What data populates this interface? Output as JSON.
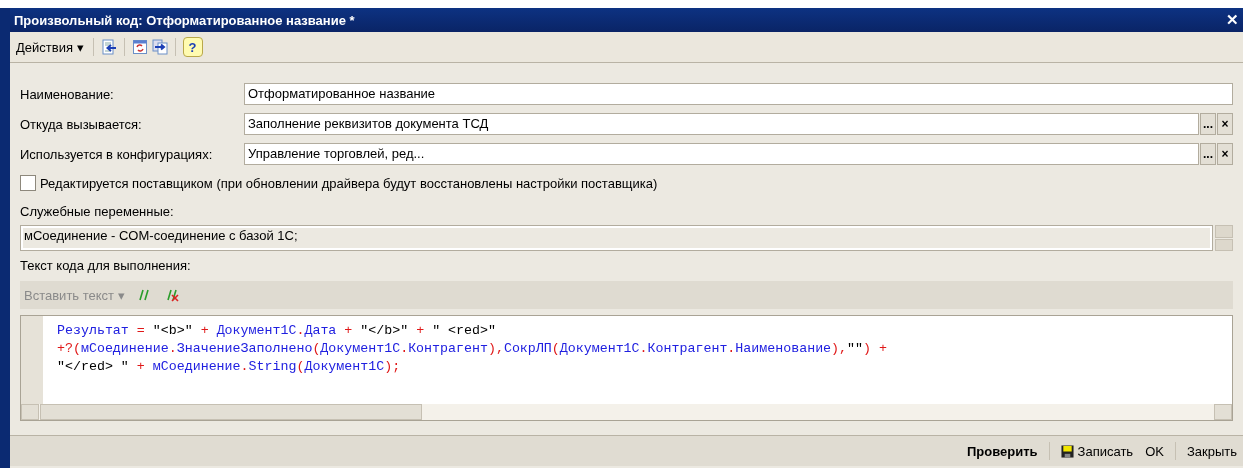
{
  "window": {
    "title": "Произвольный код: Отформатированное название *",
    "close": "✕"
  },
  "toolbar": {
    "menu": "Действия ▾",
    "help": "?"
  },
  "fields": [
    {
      "label": "Наименование:",
      "value": "Отформатированное название"
    },
    {
      "label": "Откуда вызывается:",
      "value": "Заполнение реквизитов документа ТСД",
      "buttons": [
        "...",
        "×"
      ]
    },
    {
      "label": "Используется в конфигурациях:",
      "value": "Управление торговлей, ред...",
      "buttons": [
        "...",
        "×"
      ]
    }
  ],
  "checkbox": {
    "label": "Редактируется поставщиком (при обновлении драйвера будут восстановлены настройки поставщика)",
    "checked": false
  },
  "service_variables": {
    "label": "Служебные переменные:",
    "value": "мСоединение - COM-соединение с базой 1С;"
  },
  "code": {
    "label": "Текст кода для выполнения:",
    "insert_menu": "Вставить текст ▾",
    "lines": [
      [
        {
          "kind": "id",
          "text": "Результат"
        },
        {
          "kind": "op",
          "text": " = "
        },
        {
          "kind": "str",
          "text": "\"<b>\""
        },
        {
          "kind": "op",
          "text": " + "
        },
        {
          "kind": "id",
          "text": "Документ1С"
        },
        {
          "kind": "op",
          "text": "."
        },
        {
          "kind": "id",
          "text": "Дата"
        },
        {
          "kind": "op",
          "text": " + "
        },
        {
          "kind": "str",
          "text": "\"</b>\""
        },
        {
          "kind": "op",
          "text": " + "
        },
        {
          "kind": "str",
          "text": "\" <red>\""
        }
      ],
      [
        {
          "kind": "op",
          "text": "+?("
        },
        {
          "kind": "id",
          "text": "мСоединение"
        },
        {
          "kind": "op",
          "text": "."
        },
        {
          "kind": "id",
          "text": "ЗначениеЗаполнено"
        },
        {
          "kind": "op",
          "text": "("
        },
        {
          "kind": "id",
          "text": "Документ1С"
        },
        {
          "kind": "op",
          "text": "."
        },
        {
          "kind": "id",
          "text": "Контрагент"
        },
        {
          "kind": "op",
          "text": "),"
        },
        {
          "kind": "id",
          "text": "СокрЛП"
        },
        {
          "kind": "op",
          "text": "("
        },
        {
          "kind": "id",
          "text": "Документ1С"
        },
        {
          "kind": "op",
          "text": "."
        },
        {
          "kind": "id",
          "text": "Контрагент"
        },
        {
          "kind": "op",
          "text": "."
        },
        {
          "kind": "id",
          "text": "Наименование"
        },
        {
          "kind": "op",
          "text": "),"
        },
        {
          "kind": "str",
          "text": "\"\""
        },
        {
          "kind": "op",
          "text": ") +"
        }
      ],
      [
        {
          "kind": "str",
          "text": "\"</red> \""
        },
        {
          "kind": "op",
          "text": " + "
        },
        {
          "kind": "id",
          "text": "мСоединение"
        },
        {
          "kind": "op",
          "text": "."
        },
        {
          "kind": "id",
          "text": "String"
        },
        {
          "kind": "op",
          "text": "("
        },
        {
          "kind": "id",
          "text": "Документ1С"
        },
        {
          "kind": "op",
          "text": ");"
        }
      ]
    ]
  },
  "footer": {
    "buttons": [
      {
        "label": "Проверить",
        "kind": "bold"
      },
      {
        "label": "Записать",
        "kind": "save"
      },
      {
        "label": "OK",
        "kind": "plain"
      },
      {
        "label": "Закрыть",
        "kind": "plain"
      }
    ]
  }
}
